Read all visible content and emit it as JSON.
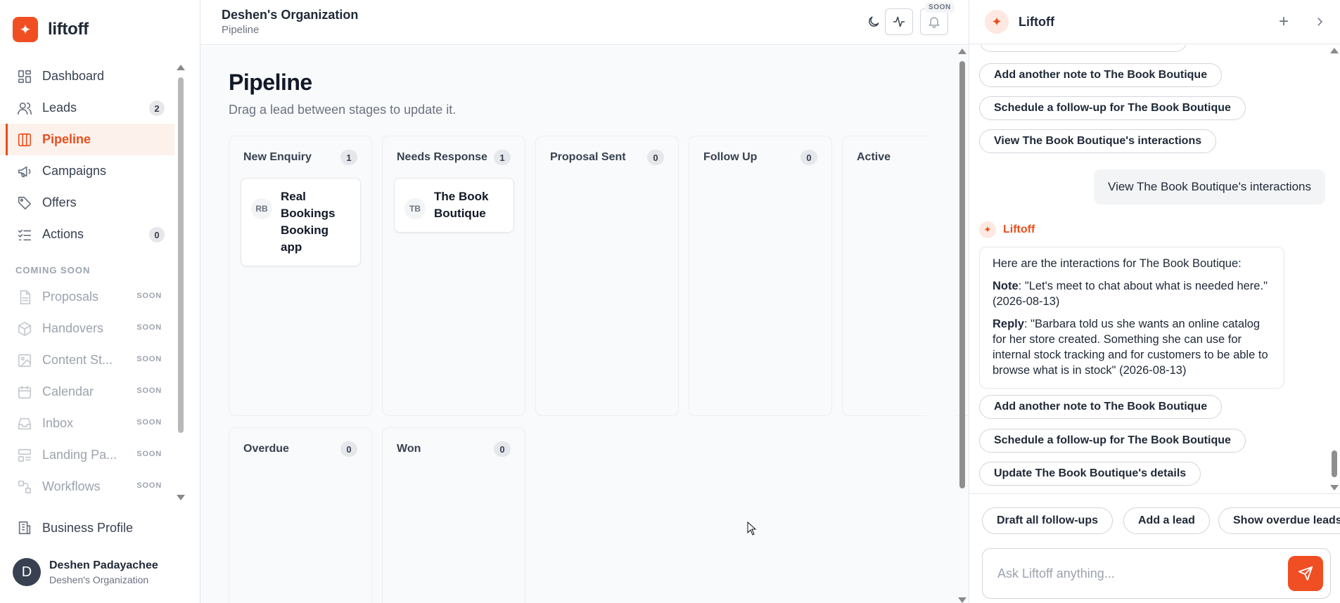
{
  "brand": {
    "name": "liftoff",
    "accent": "#f04e23"
  },
  "sidebar": {
    "items": [
      {
        "label": "Dashboard",
        "icon": "dashboard-icon"
      },
      {
        "label": "Leads",
        "icon": "users-icon",
        "badge": "2"
      },
      {
        "label": "Pipeline",
        "icon": "columns-icon",
        "active": true
      },
      {
        "label": "Campaigns",
        "icon": "megaphone-icon"
      },
      {
        "label": "Offers",
        "icon": "tag-icon"
      },
      {
        "label": "Actions",
        "icon": "checklist-icon",
        "badge": "0"
      }
    ],
    "coming_soon_label": "COMING SOON",
    "soon_items": [
      {
        "label": "Proposals",
        "icon": "document-icon",
        "tag": "SOON"
      },
      {
        "label": "Handovers",
        "icon": "box-icon",
        "tag": "SOON"
      },
      {
        "label": "Content St...",
        "icon": "image-icon",
        "tag": "SOON"
      },
      {
        "label": "Calendar",
        "icon": "calendar-icon",
        "tag": "SOON"
      },
      {
        "label": "Inbox",
        "icon": "inbox-icon",
        "tag": "SOON"
      },
      {
        "label": "Landing Pa...",
        "icon": "layout-icon",
        "tag": "SOON"
      },
      {
        "label": "Workflows",
        "icon": "workflow-icon",
        "tag": "SOON"
      }
    ],
    "business_profile": "Business Profile",
    "user": {
      "initial": "D",
      "name": "Deshen Padayachee",
      "org": "Deshen's Organization"
    }
  },
  "topbar": {
    "org_title": "Deshen's Organization",
    "breadcrumb": "Pipeline",
    "soon_chip": "SOON"
  },
  "main": {
    "title": "Pipeline",
    "subtitle": "Drag a lead between stages to update it.",
    "columns": [
      {
        "name": "New Enquiry",
        "count": "1",
        "cards": [
          {
            "initials": "RB",
            "title": "Real Bookings Booking app"
          }
        ]
      },
      {
        "name": "Needs Response",
        "count": "1",
        "cards": [
          {
            "initials": "TB",
            "title": "The Book Boutique"
          }
        ]
      },
      {
        "name": "Proposal Sent",
        "count": "0",
        "cards": []
      },
      {
        "name": "Follow Up",
        "count": "0",
        "cards": []
      },
      {
        "name": "Active",
        "count": "",
        "cards": []
      },
      {
        "name": "Overdue",
        "count": "0",
        "cards": []
      },
      {
        "name": "Won",
        "count": "0",
        "cards": []
      }
    ]
  },
  "chat": {
    "title": "Liftoff",
    "plus": "+",
    "chips_top": [
      "Add another note to The Book Boutique",
      "Schedule a follow-up for The Book Boutique",
      "View The Book Boutique's interactions"
    ],
    "user_message": "View The Book Boutique's interactions",
    "assistant_name": "Liftoff",
    "response": {
      "intro": "Here are the interactions for The Book Boutique:",
      "note_label": "Note",
      "note_text": ": \"Let's meet to chat about what is needed here.\" (2026-08-13)",
      "reply_label": "Reply",
      "reply_text": ": \"Barbara told us she wants an online catalog for her store created. Something she can use for internal stock tracking and for customers to be able to browse what is in stock\" (2026-08-13)"
    },
    "chips_bottom": [
      "Add another note to The Book Boutique",
      "Schedule a follow-up for The Book Boutique",
      "Update The Book Boutique's details"
    ],
    "suggestions": [
      "Draft all follow-ups",
      "Add a lead",
      "Show overdue leads"
    ],
    "input_placeholder": "Ask Liftoff anything..."
  }
}
